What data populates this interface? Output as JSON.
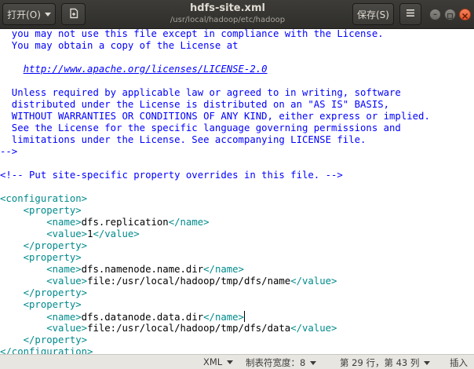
{
  "header": {
    "open_label": "打开(O)",
    "title": "hdfs-site.xml",
    "path": "/usr/local/hadoop/etc/hadoop",
    "save_label": "保存(S)",
    "menu_icon": "hamburger-menu-icon",
    "new_tab_icon": "new-document-icon"
  },
  "editor": {
    "lines": [
      [
        {
          "c": "comment",
          "t": "  you may not use this file except in compliance with the License."
        }
      ],
      [
        {
          "c": "comment",
          "t": "  You may obtain a copy of the License at"
        }
      ],
      [
        {
          "c": "comment",
          "t": ""
        }
      ],
      [
        {
          "c": "comment",
          "t": "    "
        },
        {
          "c": "link",
          "t": "http://www.apache.org/licenses/LICENSE-2.0"
        }
      ],
      [
        {
          "c": "comment",
          "t": ""
        }
      ],
      [
        {
          "c": "comment",
          "t": "  Unless required by applicable law or agreed to in writing, software"
        }
      ],
      [
        {
          "c": "comment",
          "t": "  distributed under the License is distributed on an \"AS IS\" BASIS,"
        }
      ],
      [
        {
          "c": "comment",
          "t": "  WITHOUT WARRANTIES OR CONDITIONS OF ANY KIND, either express or implied."
        }
      ],
      [
        {
          "c": "comment",
          "t": "  See the License for the specific language governing permissions and"
        }
      ],
      [
        {
          "c": "comment",
          "t": "  limitations under the License. See accompanying LICENSE file."
        }
      ],
      [
        {
          "c": "comment",
          "t": "-->"
        }
      ],
      [
        {
          "c": "txt",
          "t": ""
        }
      ],
      [
        {
          "c": "comment",
          "t": "<!-- Put site-specific property overrides in this file. -->"
        }
      ],
      [
        {
          "c": "txt",
          "t": ""
        }
      ],
      [
        {
          "c": "tag",
          "t": "<configuration>"
        }
      ],
      [
        {
          "c": "txt",
          "t": "    "
        },
        {
          "c": "tag",
          "t": "<property>"
        }
      ],
      [
        {
          "c": "txt",
          "t": "        "
        },
        {
          "c": "tag",
          "t": "<name>"
        },
        {
          "c": "txt",
          "t": "dfs.replication"
        },
        {
          "c": "tag",
          "t": "</name>"
        }
      ],
      [
        {
          "c": "txt",
          "t": "        "
        },
        {
          "c": "tag",
          "t": "<value>"
        },
        {
          "c": "txt",
          "t": "1"
        },
        {
          "c": "tag",
          "t": "</value>"
        }
      ],
      [
        {
          "c": "txt",
          "t": "    "
        },
        {
          "c": "tag",
          "t": "</property>"
        }
      ],
      [
        {
          "c": "txt",
          "t": "    "
        },
        {
          "c": "tag",
          "t": "<property>"
        }
      ],
      [
        {
          "c": "txt",
          "t": "        "
        },
        {
          "c": "tag",
          "t": "<name>"
        },
        {
          "c": "txt",
          "t": "dfs.namenode.name.dir"
        },
        {
          "c": "tag",
          "t": "</name>"
        }
      ],
      [
        {
          "c": "txt",
          "t": "        "
        },
        {
          "c": "tag",
          "t": "<value>"
        },
        {
          "c": "txt",
          "t": "file:/usr/local/hadoop/tmp/dfs/name"
        },
        {
          "c": "tag",
          "t": "</value>"
        }
      ],
      [
        {
          "c": "txt",
          "t": "    "
        },
        {
          "c": "tag",
          "t": "</property>"
        }
      ],
      [
        {
          "c": "txt",
          "t": "    "
        },
        {
          "c": "tag",
          "t": "<property>"
        }
      ],
      [
        {
          "c": "txt",
          "t": "        "
        },
        {
          "c": "tag",
          "t": "<name>"
        },
        {
          "c": "txt",
          "t": "dfs.datanode.data.dir"
        },
        {
          "c": "tag",
          "t": "</name>"
        },
        {
          "c": "cursor",
          "t": ""
        }
      ],
      [
        {
          "c": "txt",
          "t": "        "
        },
        {
          "c": "tag",
          "t": "<value>"
        },
        {
          "c": "txt",
          "t": "file:/usr/local/hadoop/tmp/dfs/data"
        },
        {
          "c": "tag",
          "t": "</value>"
        }
      ],
      [
        {
          "c": "txt",
          "t": "    "
        },
        {
          "c": "tag",
          "t": "</property>"
        }
      ],
      [
        {
          "c": "tag",
          "t": "</configuration>"
        }
      ]
    ]
  },
  "statusbar": {
    "language": "XML",
    "tab_width": "制表符宽度：8",
    "position": "第 29 行，第 43 列",
    "insert_mode": "插入"
  },
  "colors": {
    "comment": "#0000ff",
    "tag": "#008a8c",
    "text": "#000000",
    "header_bg": "#2f2e2b",
    "close_button": "#e4552a"
  }
}
